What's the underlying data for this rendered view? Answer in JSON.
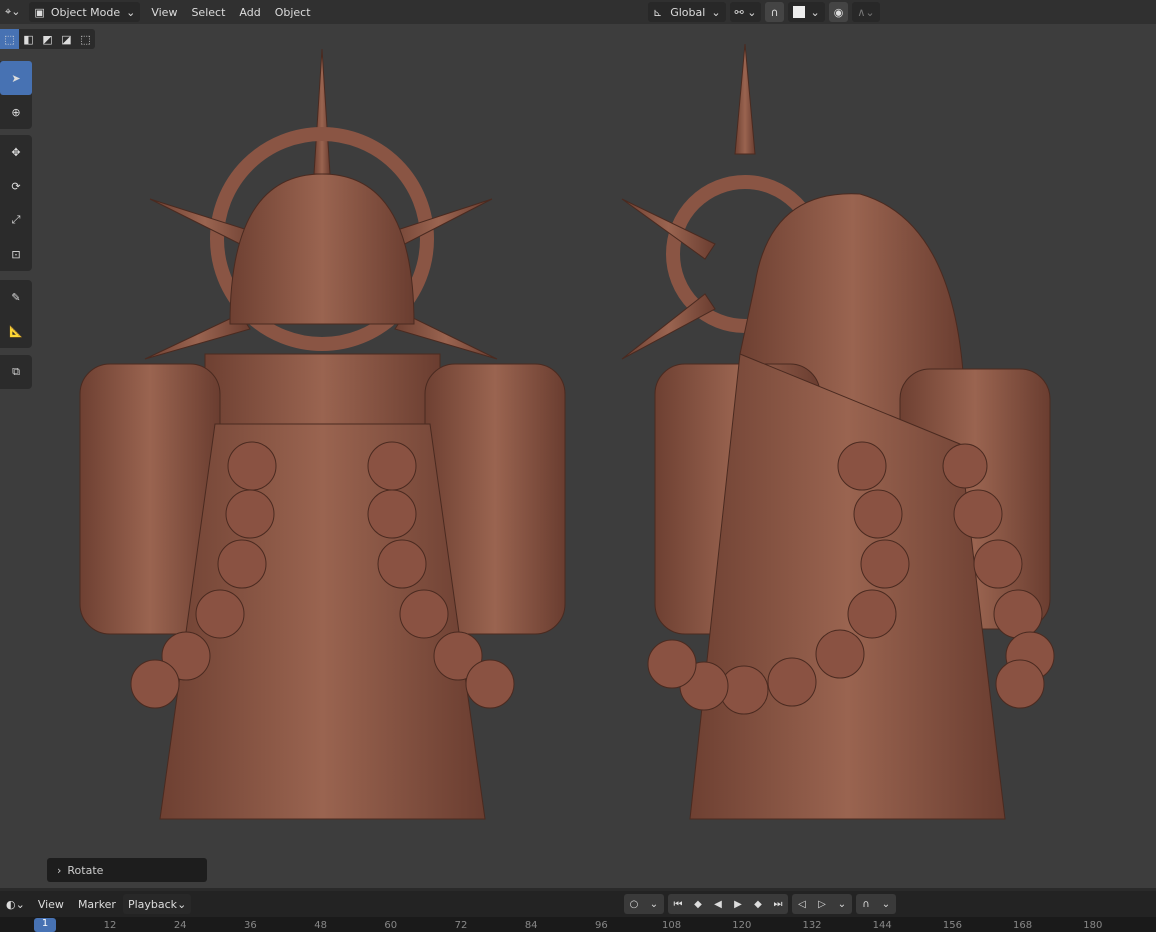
{
  "header": {
    "mode": "Object Mode",
    "menus": [
      "View",
      "Select",
      "Add",
      "Object"
    ],
    "orientation": "Global"
  },
  "operator_panel": {
    "label": "Rotate"
  },
  "timeline": {
    "menus": [
      "View",
      "Marker",
      "Playback"
    ],
    "current_frame": "1",
    "ticks": [
      "12",
      "24",
      "36",
      "48",
      "60",
      "72",
      "84",
      "96",
      "108",
      "120",
      "132",
      "144",
      "156",
      "168",
      "180"
    ]
  },
  "colors": {
    "accent": "#4772b3",
    "model": "#8a5544"
  }
}
